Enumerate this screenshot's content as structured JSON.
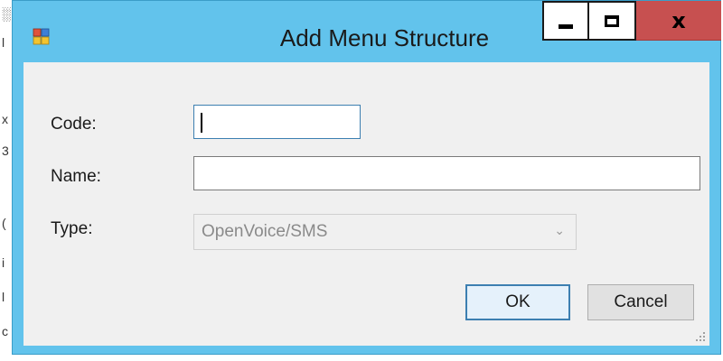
{
  "window": {
    "title": "Add Menu Structure",
    "minimize_label": "",
    "maximize_label": "",
    "close_label": "x"
  },
  "form": {
    "code_label": "Code:",
    "code_value": "",
    "name_label": "Name:",
    "name_value": "",
    "type_label": "Type:",
    "type_value": "OpenVoice/SMS"
  },
  "buttons": {
    "ok_label": "OK",
    "cancel_label": "Cancel"
  },
  "background_app": {
    "edge_glyphs": [
      "░",
      "l",
      "x",
      "3",
      "(",
      "i",
      "l",
      "c"
    ]
  },
  "colors": {
    "title_bar": "#62c3ec",
    "close_button": "#c75050",
    "client_background": "#f0f0f0",
    "focus_border": "#3c7fb1"
  }
}
